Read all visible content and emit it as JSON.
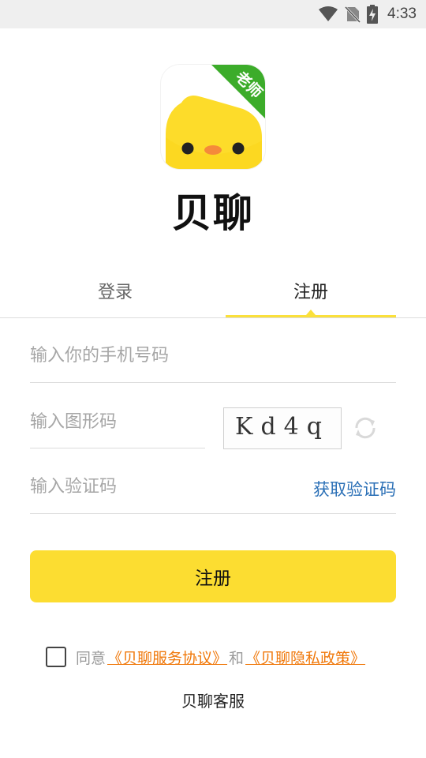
{
  "status_bar": {
    "time": "4:33",
    "icons": [
      "wifi-icon",
      "no-sim-icon",
      "battery-charging-icon"
    ]
  },
  "app": {
    "name": "贝聊",
    "badge": "老师"
  },
  "tabs": [
    {
      "label": "登录",
      "selected": false
    },
    {
      "label": "注册",
      "selected": true
    }
  ],
  "form": {
    "phone_placeholder": "输入你的手机号码",
    "captcha_placeholder": "输入图形码",
    "captcha_text": "Kd4q",
    "code_placeholder": "输入验证码",
    "get_code_label": "获取验证码"
  },
  "submit_label": "注册",
  "agreement": {
    "prefix": "同意",
    "service_link": "《贝聊服务协议》",
    "and": "和",
    "privacy_link": "《贝聊隐私政策》",
    "checked": false
  },
  "support_label": "贝聊客服",
  "colors": {
    "accent": "#fcdd31",
    "link_orange": "#f0780a",
    "link_blue": "#2a6fb6",
    "badge_green": "#3cac2a"
  }
}
